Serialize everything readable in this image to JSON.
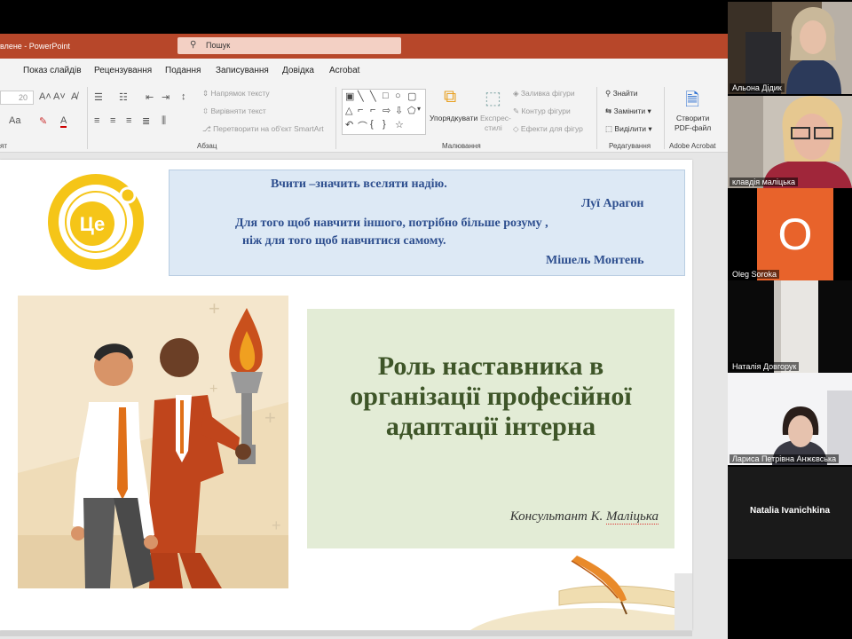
{
  "app": {
    "doc_title": "влене - PowerPoint",
    "search_placeholder": "Пошук"
  },
  "tabs": [
    "Показ слайдів",
    "Рецензування",
    "Подання",
    "Записування",
    "Довідка",
    "Acrobat"
  ],
  "ribbon": {
    "paragraph": {
      "label": "Абзац",
      "text_direction": "Напрямок тексту",
      "align_text": "Вирівняти текст",
      "smartart": "Перетворити на об'єкт SmartArt"
    },
    "drawing": {
      "label": "Малювання",
      "arrange": "Упорядкувати",
      "quick_styles_1": "Експрес-",
      "quick_styles_2": "стилі",
      "shape_fill": "Заливка фігури",
      "shape_outline": "Контур фігури",
      "shape_effects": "Ефекти для фігур"
    },
    "editing": {
      "label": "Редагування",
      "find": "Знайти",
      "replace": "Замінити",
      "select": "Виділити"
    },
    "acrobat": {
      "label": "Adobe Acrobat",
      "create_pdf_1": "Створити",
      "create_pdf_2": "PDF-файл"
    },
    "font": {
      "size": "20",
      "group_cut": "ят"
    }
  },
  "slide": {
    "logo_text": "Це",
    "quote1": "Вчити –значить вселяти надію.",
    "author1": "Луї Арагон",
    "quote2_line1": "Для того щоб навчити іншого, потрібно більше розуму ,",
    "quote2_line2": "ніж для того щоб навчитися самому.",
    "author2": "Мішель Монтень",
    "title_line1": "Роль наставника в",
    "title_line2": "організації професійної",
    "title_line3": "адаптації інтерна",
    "consultant_prefix": "Консультант К. ",
    "consultant_name": "Маліцька"
  },
  "participants": [
    {
      "name": "Альона Дідик"
    },
    {
      "name": "клавдія маліцька"
    },
    {
      "name": "Oleg Soroka",
      "initial": "O"
    },
    {
      "name": "Наталія Довгорук"
    },
    {
      "name": "Лариса Петрівна Анжєвська"
    },
    {
      "name": "Natalia Ivanichkina"
    }
  ],
  "colors": {
    "ppt_accent": "#b7472a",
    "avatar_orange": "#e8632b",
    "quote_text": "#2e4f8f",
    "title_text": "#3e5528"
  }
}
